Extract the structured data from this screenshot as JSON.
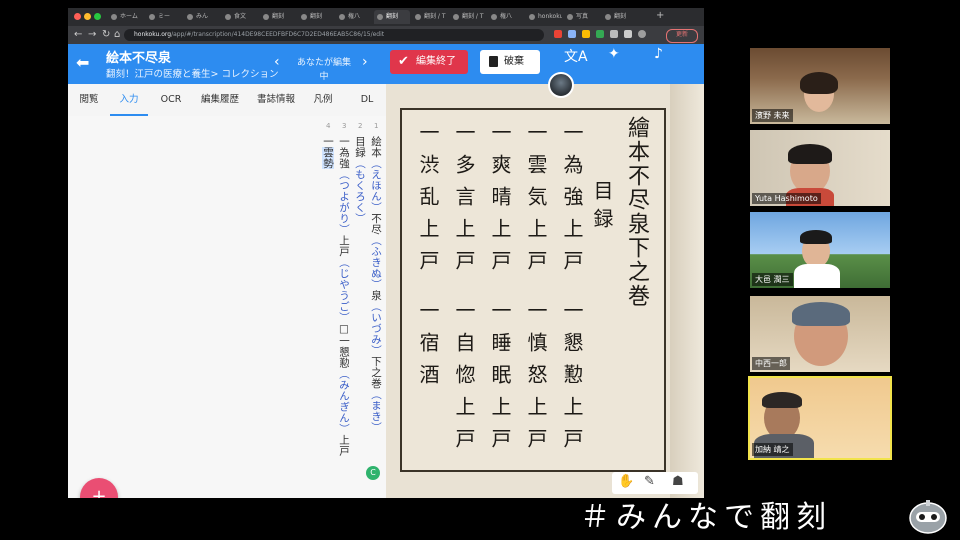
{
  "browser": {
    "tabs": [
      {
        "label": "ホーム"
      },
      {
        "label": "ミー"
      },
      {
        "label": "みん"
      },
      {
        "label": "食文"
      },
      {
        "label": "翻刻"
      },
      {
        "label": "翻刻"
      },
      {
        "label": "権八"
      },
      {
        "label": "翻刻"
      },
      {
        "label": "翻刻 / T"
      },
      {
        "label": "翻刻 / T"
      },
      {
        "label": "権八"
      },
      {
        "label": "honkoku"
      },
      {
        "label": "写真"
      },
      {
        "label": "翻刻"
      }
    ],
    "url_host": "honkoku.org",
    "url_path": "/app/#/transcription/414DE98CEEDFBFD6C7D2ED486EAB5C86/15/edit",
    "profile_label": "更新"
  },
  "app": {
    "title": "絵本不尽泉",
    "subtitle": "翻刻！江戸の医療と養生> コレクション",
    "editing_label": "あなたが編集中",
    "finish_label": "編集終了",
    "discard_label": "破棄"
  },
  "panel": {
    "tabs": [
      {
        "label": "閲覧"
      },
      {
        "label": "入力"
      },
      {
        "label": "OCR"
      },
      {
        "label": "編集履歴"
      },
      {
        "label": "書誌情報"
      },
      {
        "label": "凡例"
      },
      {
        "label": "DL"
      }
    ],
    "line_numbers": [
      "4",
      "3",
      "2",
      "1"
    ],
    "lines": [
      [
        {
          "t": "絵本",
          "r": false
        },
        {
          "t": "（えほん）",
          "r": true
        },
        {
          "t": "不尽",
          "r": false
        },
        {
          "t": "（ふきぬ）",
          "r": true
        },
        {
          "t": "泉",
          "r": false
        },
        {
          "t": "（いづみ）",
          "r": true
        },
        {
          "t": "下之巻",
          "r": false
        },
        {
          "t": "（まき）",
          "r": true
        }
      ],
      [
        {
          "t": "目録",
          "r": false
        },
        {
          "t": "（もくろく）",
          "r": true
        }
      ],
      [
        {
          "t": "一為強",
          "r": false
        },
        {
          "t": "（つよがり）",
          "r": true
        },
        {
          "t": "上戸",
          "r": false
        },
        {
          "t": "（じやうご）",
          "r": true
        },
        {
          "t": "□一懇懃",
          "r": false
        },
        {
          "t": "（みんぎん）",
          "r": true
        },
        {
          "t": "上戸",
          "r": false
        }
      ],
      [
        {
          "t": "一",
          "r": false
        },
        {
          "t": "雲勢",
          "r": false,
          "hl": true
        }
      ]
    ],
    "fab_label": "+",
    "status_label": "C"
  },
  "scan": {
    "title_line": "繪本不尽泉下之巻",
    "sub_line": "目録",
    "columns": [
      "一為強上戸",
      "一雲気上戸",
      "一爽晴上戸",
      "一多言上戸",
      "一渋乱上戸",
      "一懇懃上戸",
      "一慎怒上戸",
      "一睡眠上戸",
      "一自惚上戸",
      "一宿酒"
    ]
  },
  "participants": [
    {
      "name": "濱野 未来"
    },
    {
      "name": "Yuta Hashimoto"
    },
    {
      "name": "大邑 潤三"
    },
    {
      "name": "中西一郎"
    },
    {
      "name": "加納 靖之"
    }
  ],
  "hashtag": "＃みんなで翻刻"
}
